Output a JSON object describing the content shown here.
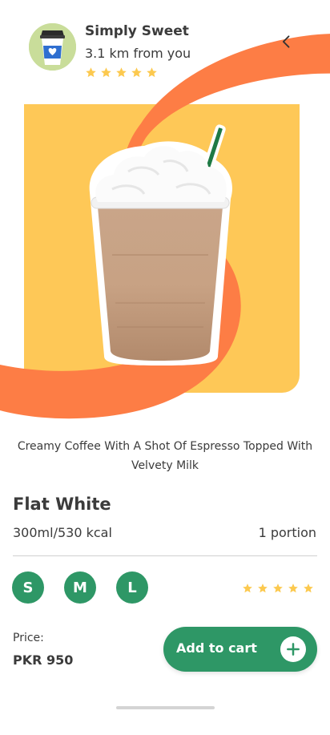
{
  "store": {
    "name": "Simply Sweet",
    "distance": "3.1 km from you",
    "rating_stars": 5
  },
  "navigation": {
    "back_icon": "chevron-left-icon"
  },
  "product": {
    "description": "Creamy Coffee With A Shot Of Espresso Topped With Velvety Milk",
    "name": "Flat White",
    "volume": "300ml/530 kcal",
    "portion": "1 portion",
    "rating_stars": 5,
    "image": "iced-coffee-drink-image"
  },
  "sizes": [
    {
      "label": "S"
    },
    {
      "label": "M"
    },
    {
      "label": "L"
    }
  ],
  "price": {
    "label": "Price:",
    "value": "PKR 950"
  },
  "cart": {
    "label": "Add to cart",
    "icon": "plus-icon"
  },
  "colors": {
    "accent_green": "#2e9766",
    "card_yellow": "#fec857",
    "ribbon_orange": "#fd7d45",
    "star_yellow": "#fcc94f",
    "avatar_bg": "#c9dd9a"
  }
}
